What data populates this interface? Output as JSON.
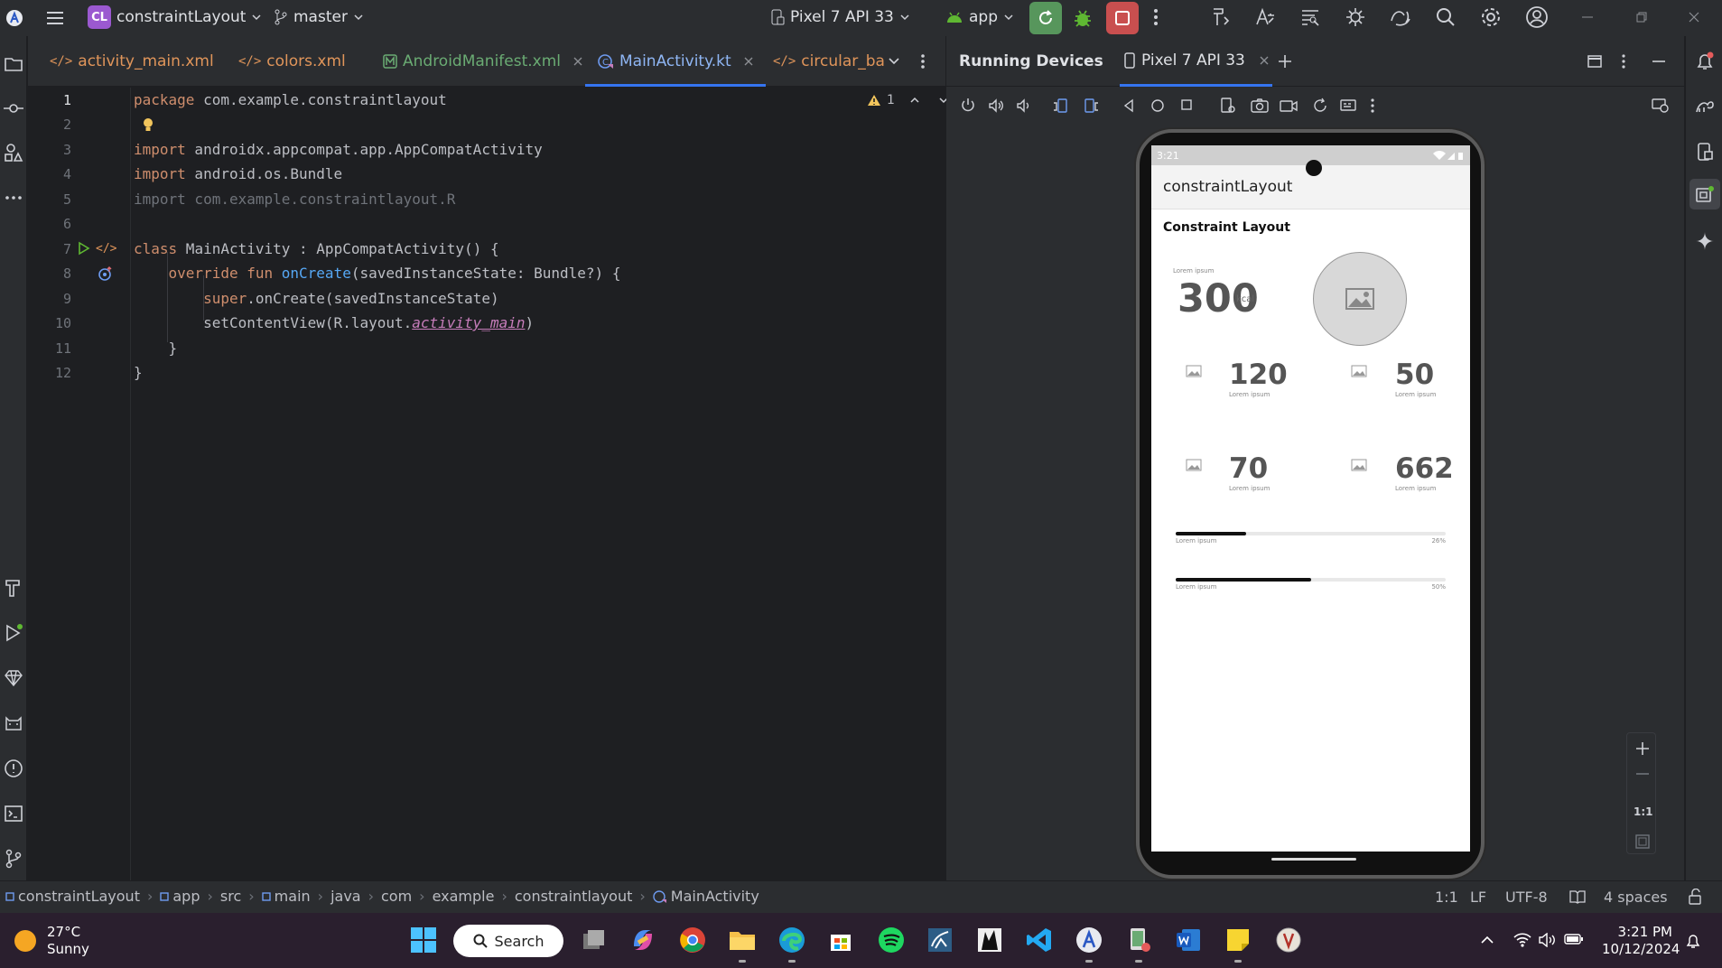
{
  "titlebar": {
    "project_badge": "CL",
    "project_name": "constraintLayout",
    "branch": "master",
    "device": "Pixel 7 API 33",
    "run_config": "app"
  },
  "editor_tabs": [
    {
      "label": "activity_main.xml",
      "icon": "xml-icon"
    },
    {
      "label": "colors.xml",
      "icon": "xml-icon"
    },
    {
      "label": "AndroidManifest.xml",
      "icon": "manifest-icon"
    },
    {
      "label": "MainActivity.kt",
      "icon": "kotlin-icon"
    },
    {
      "label": "circular_ba",
      "icon": "xml-icon"
    }
  ],
  "warnings_count": "1",
  "code": {
    "line_numbers": [
      "1",
      "2",
      "3",
      "4",
      "5",
      "6",
      "7",
      "8",
      "9",
      "10",
      "11",
      "12"
    ],
    "l1a": "package",
    "l1b": " com.example.constraintlayout",
    "l3a": "import",
    "l3b": " androidx.appcompat.app.AppCompatActivity",
    "l4a": "import",
    "l4b": " android.os.Bundle",
    "l5": "import com.example.constraintlayout.R",
    "l7a": "class",
    "l7b": " MainActivity : AppCompatActivity() {",
    "l8a": "    override fun ",
    "l8b": "onCreate",
    "l8c": "(savedInstanceState: Bundle?) {",
    "l9a": "        super",
    "l9b": ".onCreate(savedInstanceState)",
    "l10a": "        setContentView(R.layout.",
    "l10b": "activity_main",
    "l10c": ")",
    "l11": "    }",
    "l12": "}"
  },
  "running_devices": {
    "title": "Running Devices",
    "device_tab": "Pixel 7 API 33"
  },
  "phone": {
    "time": "3:21",
    "app_title": "constraintLayout",
    "heading": "Constraint Layout",
    "lorem": "Lorem ipsum",
    "main_value": "300",
    "main_unit": "kcal",
    "stats": [
      "120",
      "50",
      "70",
      "662"
    ],
    "progress": [
      {
        "label": "Lorem ipsum",
        "percent_text": "26%",
        "value": 0.26
      },
      {
        "label": "Lorem ipsum",
        "percent_text": "50%",
        "value": 0.5
      }
    ]
  },
  "zoom": {
    "ratio": "1:1"
  },
  "status": {
    "breadcrumb": [
      "constraintLayout",
      "app",
      "src",
      "main",
      "java",
      "com",
      "example",
      "constraintlayout",
      "MainActivity"
    ],
    "position": "1:1",
    "line_sep": "LF",
    "encoding": "UTF-8",
    "indent": "4 spaces"
  },
  "taskbar": {
    "temp": "27°C",
    "weather": "Sunny",
    "search": "Search",
    "time": "3:21 PM",
    "date": "10/12/2024"
  }
}
